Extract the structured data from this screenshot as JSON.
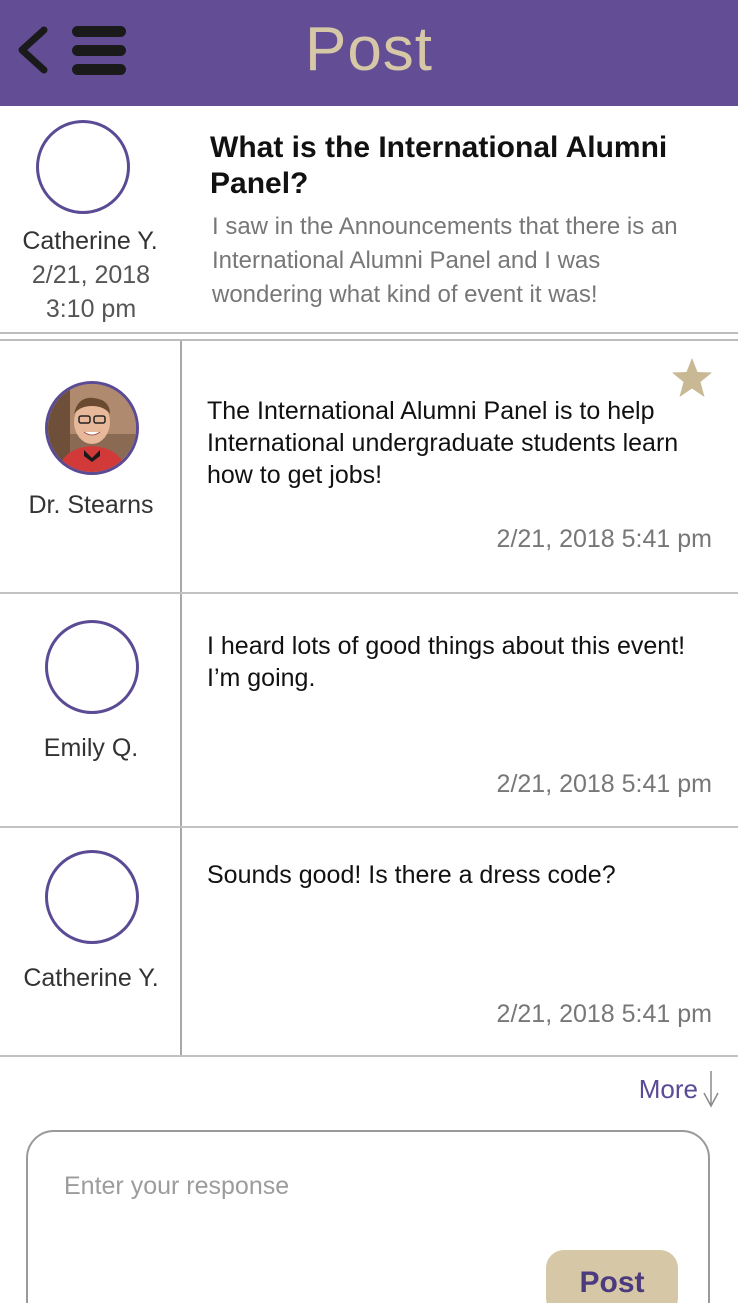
{
  "header": {
    "title": "Post",
    "back_icon": "chevron-left-icon",
    "menu_icon": "hamburger-menu-icon",
    "background_color": "#634e96",
    "title_color": "#d6c8a6"
  },
  "question": {
    "author": "Catherine Y.",
    "date": "2/21, 2018",
    "time": "3:10 pm",
    "title": "What is the International Alumni Panel?",
    "body": "I saw in the Announcements that there is an International Alumni Panel and I was wondering what kind of event it was!"
  },
  "replies": [
    {
      "author": "Dr. Stearns",
      "message": "The International Alumni Panel is to help International undergraduate students learn how to get jobs!",
      "timestamp": "2/21, 2018 5:41 pm",
      "starred": true,
      "avatar": "photo"
    },
    {
      "author": "Emily Q.",
      "message": "I heard lots of good things about this event! I’m going.",
      "timestamp": "2/21, 2018 5:41 pm",
      "starred": false,
      "avatar": "empty"
    },
    {
      "author": "Catherine Y.",
      "message": "Sounds good! Is there a dress code?",
      "timestamp": "2/21, 2018 5:41 pm",
      "starred": false,
      "avatar": "empty"
    }
  ],
  "more": {
    "label": "More",
    "icon": "arrow-down-icon"
  },
  "response": {
    "placeholder": "Enter your response",
    "value": "",
    "post_label": "Post"
  },
  "colors": {
    "accent_purple": "#634e96",
    "accent_gold": "#d6c8a6",
    "star": "#c8b994"
  }
}
